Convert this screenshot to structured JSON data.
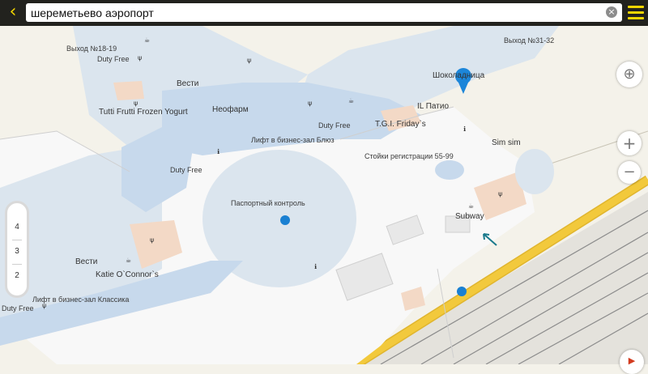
{
  "search": {
    "value": "шереметьево аэропорт"
  },
  "controls": {
    "back_icon": "chevron-left-icon",
    "clear_icon": "clear-icon",
    "menu_icon": "hamburger-menu-icon",
    "locate_icon": "crosshair-icon",
    "zoom_in_label": "+",
    "zoom_out_label": "−",
    "route_icon": "play-icon",
    "floors": [
      "4",
      "3",
      "2"
    ]
  },
  "colors": {
    "top_bar": "#22221e",
    "accent": "#f2d500",
    "pin": "#1c86d9",
    "dot": "#1a80d2",
    "terminal_floor": "#dbe5ee",
    "terminal_walkway": "#c7d9ec",
    "shop": "#f3d9c6",
    "road": "#f2c93c",
    "railway": "#8c8c8c",
    "arrow": "#1a7a8c"
  },
  "labels": {
    "exit_18_19": "Выход №18-19",
    "duty_free_1": "Duty Free",
    "vesti_1": "Вести",
    "tutti_frutti": "Tutti Frutti Frozen Yogurt",
    "neopharm": "Неофарм",
    "exit_31_32": "Выход №31-32",
    "shokoladnitsa": "Шоколадница",
    "il_patio": "IL Патио",
    "duty_free_2": "Duty Free",
    "tgi_fridays": "T.G.I. Friday`s",
    "lift_bliz": "Лифт в бизнес-зал Блюз",
    "checkin": "Стойки регистрации 55-99",
    "sim_sim": "Sim sim",
    "duty_free_3": "Duty Free",
    "passport": "Паспортный контроль",
    "subway": "Subway",
    "vesti_2": "Вести",
    "katie": "Katie O`Connor`s",
    "lift_klassika": "Лифт в бизнес-зал Классика",
    "duty_free_4": "Duty Free"
  }
}
